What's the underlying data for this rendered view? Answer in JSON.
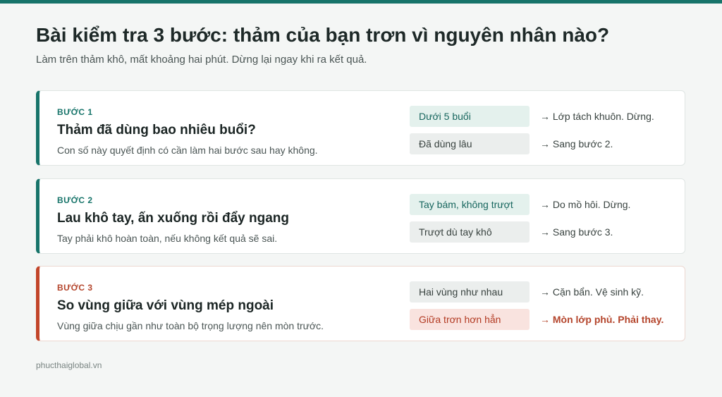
{
  "colors": {
    "accent": "#17746a",
    "warning": "#c2452a",
    "background": "#f4f6f5"
  },
  "header": {
    "title": "Bài kiểm tra 3 bước: thảm của bạn trơn vì nguyên nhân nào?",
    "subtitle": "Làm trên thảm khô, mất khoảng hai phút. Dừng lại ngay khi ra kết quả."
  },
  "steps": [
    {
      "label": "BƯỚC 1",
      "heading": "Thảm đã dùng bao nhiêu buổi?",
      "description": "Con số này quyết định có cần làm hai bước sau hay không.",
      "options": [
        {
          "choice": "Dưới 5 buổi",
          "result": "→ Lớp tách khuôn. Dừng."
        },
        {
          "choice": "Đã dùng lâu",
          "result": "→ Sang bước 2."
        }
      ]
    },
    {
      "label": "BƯỚC 2",
      "heading": "Lau khô tay, ấn xuống rồi đẩy ngang",
      "description": "Tay phải khô hoàn toàn, nếu không kết quả sẽ sai.",
      "options": [
        {
          "choice": "Tay bám, không trượt",
          "result": "→ Do mồ hôi. Dừng."
        },
        {
          "choice": "Trượt dù tay khô",
          "result": "→ Sang bước 3."
        }
      ]
    },
    {
      "label": "BƯỚC 3",
      "heading": "So vùng giữa với vùng mép ngoài",
      "description": "Vùng giữa chịu gần như toàn bộ trọng lượng nên mòn trước.",
      "options": [
        {
          "choice": "Hai vùng như nhau",
          "result": "→ Cặn bẩn. Vệ sinh kỹ."
        },
        {
          "choice": "Giữa trơn hơn hẳn",
          "result": "→ Mòn lớp phủ. Phải thay."
        }
      ]
    }
  ],
  "footer": {
    "site": "phucthaiglobal.vn"
  }
}
